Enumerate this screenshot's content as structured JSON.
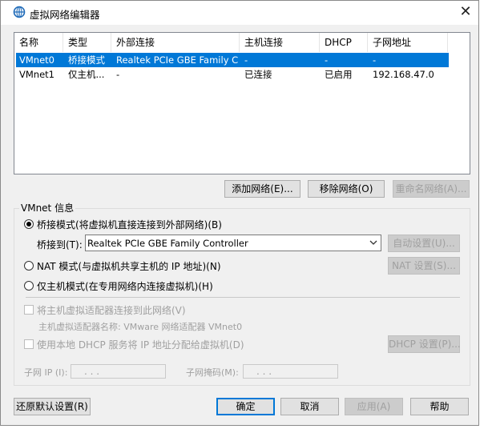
{
  "window": {
    "title": "虚拟网络编辑器",
    "close_glyph": "✕",
    "icon": "vmware-network-icon"
  },
  "table": {
    "headers": [
      "名称",
      "类型",
      "外部连接",
      "主机连接",
      "DHCP",
      "子网地址"
    ],
    "rows": [
      {
        "name": "VMnet0",
        "type": "桥接模式",
        "external": "Realtek PCIe GBE Family Co...",
        "host": "-",
        "dhcp": "-",
        "subnet": "-",
        "selected": true
      },
      {
        "name": "VMnet1",
        "type": "仅主机...",
        "external": "-",
        "host": "已连接",
        "dhcp": "已启用",
        "subnet": "192.168.47.0",
        "selected": false
      }
    ]
  },
  "network_buttons": {
    "add": "添加网络(E)...",
    "remove": "移除网络(O)",
    "rename": "重命名网络(A)..."
  },
  "vmnet_info": {
    "group_label": "VMnet 信息",
    "bridged_label": "桥接模式(将虚拟机直接连接到外部网络)(B)",
    "bridge_to_label": "桥接到(T):",
    "bridge_to_value": "Realtek PCIe GBE Family Controller",
    "auto_settings": "自动设置(U)...",
    "nat_label": "NAT 模式(与虚拟机共享主机的 IP 地址)(N)",
    "nat_settings": "NAT 设置(S)...",
    "hostonly_label": "仅主机模式(在专用网络内连接虚拟机)(H)",
    "connect_adapter_label": "将主机虚拟适配器连接到此网络(V)",
    "adapter_name_label": "主机虚拟适配器名称: VMware 网络适配器 VMnet0",
    "dhcp_label": "使用本地 DHCP 服务将 IP 地址分配给虚拟机(D)",
    "dhcp_settings": "DHCP 设置(P)...",
    "subnet_ip_label": "子网 IP (I):",
    "subnet_mask_label": "子网掩码(M):",
    "ip_placeholder": ".       .       ."
  },
  "footer": {
    "restore": "还原默认设置(R)",
    "ok": "确定",
    "cancel": "取消",
    "apply": "应用(A)",
    "help": "帮助"
  },
  "colors": {
    "selection": "#0078d7",
    "dialog_bg": "#f0f0f0"
  }
}
